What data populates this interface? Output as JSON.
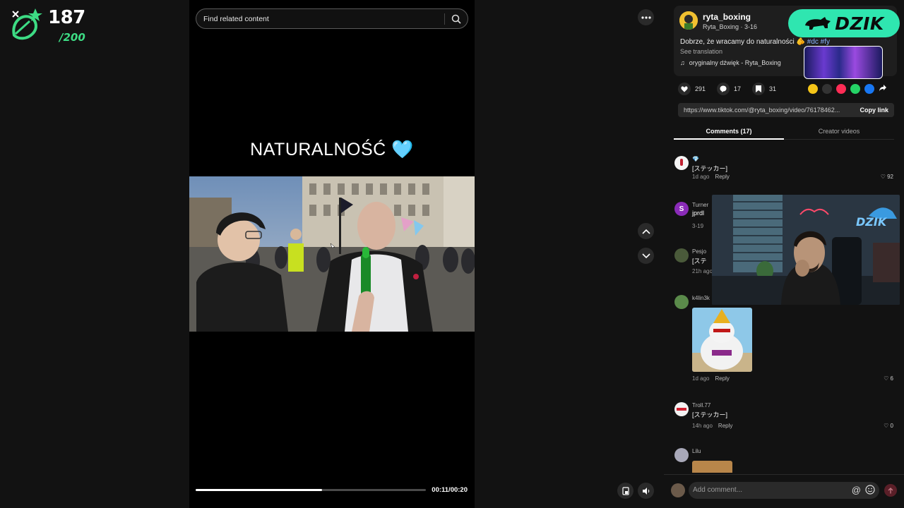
{
  "overlay": {
    "count": "187",
    "total": "/200"
  },
  "search": {
    "placeholder": "Find related content"
  },
  "video": {
    "title": "NATURALNOŚĆ",
    "title_emoji": "🩵",
    "progress": 0.55,
    "time": "00:11/00:20"
  },
  "post": {
    "username": "ryta_boxing",
    "subtitle": "Ryta_Boxing · 3-16",
    "description": "Dobrze, że wracamy do naturalności",
    "emoji": "🫵",
    "tags": "#dc #fy",
    "see_translation": "See translation",
    "music": "oryginalny dźwięk - Ryta_Boxing",
    "likes": "291",
    "comments": "17",
    "saves": "31",
    "url": "https://www.tiktok.com/@ryta_boxing/video/76178462...",
    "copy_link": "Copy link"
  },
  "sponsor": {
    "text": "DZIK"
  },
  "tabs": {
    "comments": "Comments (17)",
    "creator": "Creator videos"
  },
  "comments": [
    {
      "user": "💎",
      "text": "[ステッカー]",
      "time": "1d ago",
      "reply": "Reply",
      "likes": "92"
    },
    {
      "user": "Turner",
      "text": "jprdl",
      "time": "3-19",
      "reply": "",
      "likes": ""
    },
    {
      "user": "Pesjo",
      "text": "[ステ",
      "time": "21h ago",
      "reply": "",
      "likes": ""
    },
    {
      "user": "k4lin3k",
      "text": "",
      "time": "1d ago",
      "reply": "Reply",
      "likes": "6"
    },
    {
      "user": "Troll.77",
      "text": "[ステッカー]",
      "time": "14h ago",
      "reply": "Reply",
      "likes": "0"
    },
    {
      "user": "Lilu",
      "text": "",
      "time": "",
      "reply": "",
      "likes": ""
    }
  ],
  "composer": {
    "placeholder": "Add comment...",
    "at": "@"
  },
  "colors": {
    "accent": "#2fe6b0",
    "counter_green": "#3ddc84",
    "send": "#5a1f28"
  }
}
